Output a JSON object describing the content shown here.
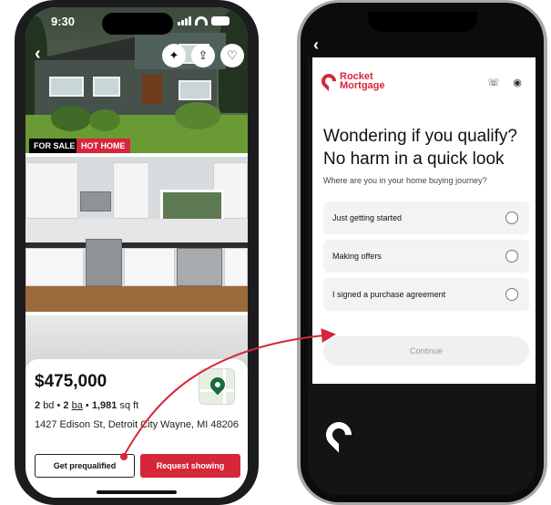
{
  "left_phone": {
    "status_time": "9:30",
    "badges": {
      "for_sale": "FOR SALE",
      "hot_home": "HOT HOME"
    },
    "listing": {
      "price": "$475,000",
      "beds": "2",
      "beds_unit": "bd",
      "baths": "2",
      "baths_unit": "ba",
      "sqft": "1,981",
      "sqft_unit": "sq ft",
      "address": "1427 Edison St, Detroit City Wayne, MI 48206"
    },
    "buttons": {
      "prequalified": "Get prequalified",
      "request_showing": "Request showing"
    }
  },
  "right_phone": {
    "brand": {
      "line1": "Rocket",
      "line2": "Mortgage"
    },
    "headline_line1": "Wondering if you qualify?",
    "headline_line2": "No harm in a quick look",
    "question": "Where are you in your home buying journey?",
    "options": [
      {
        "label": "Just getting started"
      },
      {
        "label": "Making offers"
      },
      {
        "label": "I signed a purchase agreement"
      }
    ],
    "continue_label": "Continue"
  },
  "colors": {
    "accent_red": "#d6263a",
    "map_pin_green": "#1a6a3b"
  },
  "icons": {
    "photo_actions": [
      "sparkle-icon",
      "share-icon",
      "heart-icon"
    ],
    "header_actions": [
      "phone-icon",
      "user-icon"
    ]
  }
}
